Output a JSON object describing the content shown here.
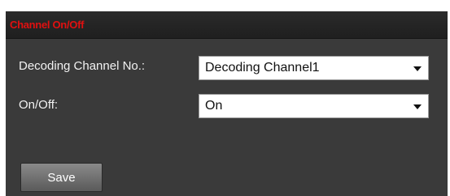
{
  "panel": {
    "title": "Channel On/Off"
  },
  "fields": {
    "decoding_channel": {
      "label": "Decoding Channel No.:",
      "value": "Decoding Channel1"
    },
    "on_off": {
      "label": "On/Off:",
      "value": "On"
    }
  },
  "actions": {
    "save_label": "Save"
  },
  "colors": {
    "title": "#e01010",
    "panel_bg": "#3a3a3a",
    "header_bg": "#222222",
    "label_text": "#f2f2f2"
  },
  "icons": {
    "dropdown": "chevron-down-icon"
  }
}
